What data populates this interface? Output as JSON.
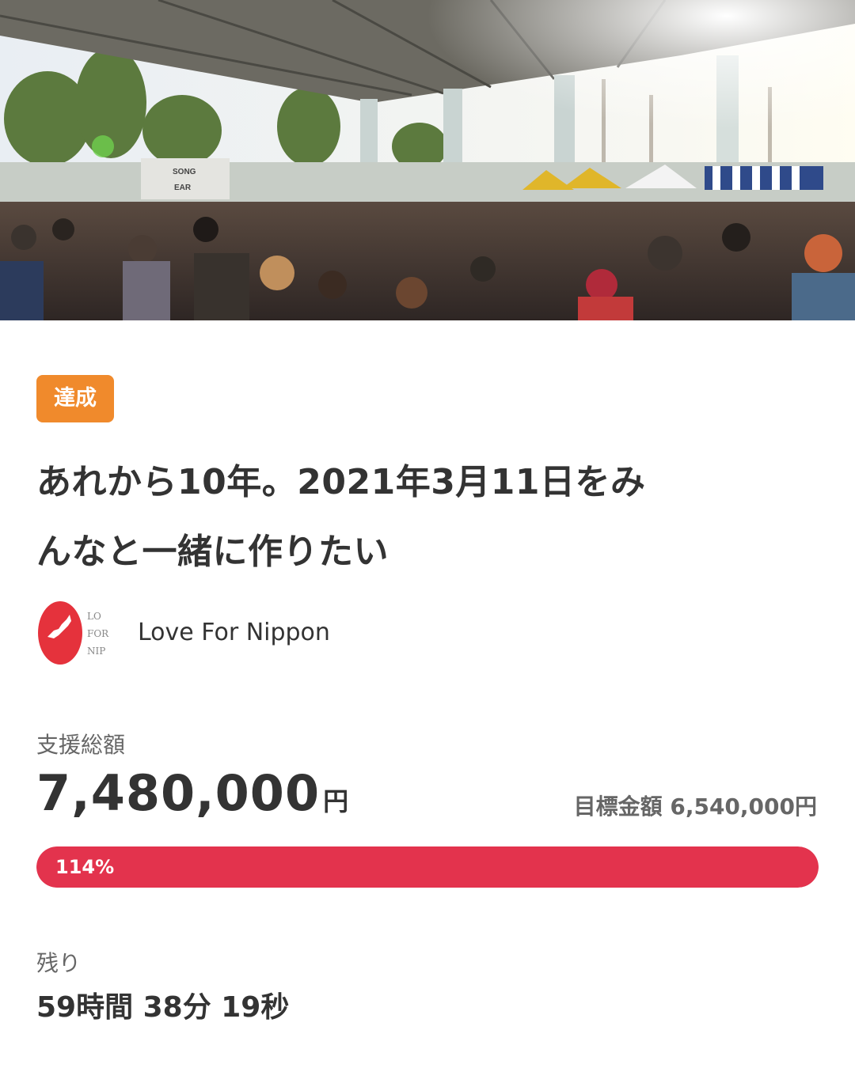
{
  "hero": {
    "image": "concert-crowd-photo",
    "stage_sign": "SONG EARTH"
  },
  "status_badge": "達成",
  "title_line1": "あれから10年。2021年3月11日をみ",
  "title_line2": "んなと一緒に作りたい",
  "owner": {
    "logo_icon": "love-for-nippon-logo",
    "logo_text": [
      "LO",
      "FOR",
      "NIP"
    ],
    "name": "Love For Nippon"
  },
  "funding": {
    "total_label": "支援総額",
    "total_value": "7,480,000",
    "total_unit": "円",
    "goal_label": "目標金額",
    "goal_value": "6,540,000円",
    "progress_label": "114%",
    "progress_percent": 114
  },
  "remaining": {
    "label": "残り",
    "value": "59時間 38分 19秒"
  },
  "colors": {
    "badge": "#f08a2c",
    "progress": "#e3334d",
    "text": "#333333",
    "muted": "#666666"
  }
}
